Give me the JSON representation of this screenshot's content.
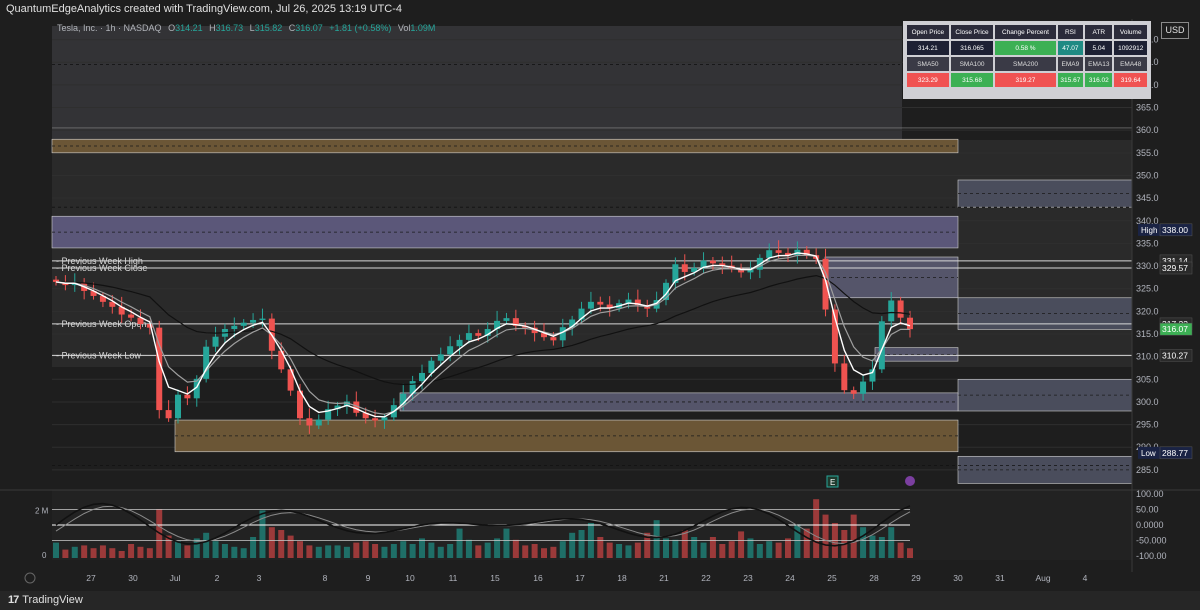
{
  "header": {
    "credit": "QuantumEdgeAnalytics created with TradingView.com, Jul 26, 2025 13:19 UTC-4"
  },
  "legend": {
    "symbol": "Tesla, Inc. · 1h · NASDAQ",
    "open_label": "O",
    "open": "314.21",
    "high_label": "H",
    "high": "316.73",
    "low_label": "L",
    "low": "315.82",
    "close_label": "C",
    "close": "316.07",
    "change": "+1.81 (+0.58%)",
    "vol_label": "Vol",
    "vol": "1.09M"
  },
  "currency": "USD",
  "stats_table": {
    "row1": [
      "Open Price",
      "Close Price",
      "Change Percent",
      "RSI",
      "ATR",
      "Volume"
    ],
    "row2": [
      "314.21",
      "316.065",
      "0.58 %",
      "47.07",
      "5.04",
      "1092912"
    ],
    "row3": [
      "SMA50",
      "SMA100",
      "SMA200",
      "EMA9",
      "EMA13",
      "EMA48"
    ],
    "row4": [
      "323.29",
      "315.68",
      "319.27",
      "315.67",
      "316.02",
      "319.64"
    ]
  },
  "colors": {
    "up": "#26a69a",
    "down": "#ef5350",
    "bg": "#1e1e1e",
    "zone_brown": "#6b5636",
    "zone_purple": "#5b5779",
    "zone_gray": "#4a4d5c"
  },
  "price_axis": {
    "min": 281,
    "max": 383,
    "ticks": [
      285,
      290,
      295,
      300,
      305,
      310,
      315,
      320,
      325,
      330,
      335,
      340,
      345,
      350,
      355,
      360,
      365,
      370,
      375,
      380
    ]
  },
  "price_tags": [
    {
      "label": "High",
      "value": 338.0,
      "text": "338.00",
      "color": "#1a2344",
      "label_show": true
    },
    {
      "label": "",
      "value": 331.14,
      "text": "331.14",
      "color": "#2a2a2a",
      "label_show": false
    },
    {
      "label": "",
      "value": 329.57,
      "text": "329.57",
      "color": "#2a2a2a",
      "label_show": false
    },
    {
      "label": "",
      "value": 317.23,
      "text": "317.23",
      "color": "#2a2a2a",
      "label_show": false
    },
    {
      "label": "",
      "value": 316.07,
      "text": "316.07",
      "color": "#3cb054",
      "label_show": false
    },
    {
      "label": "",
      "value": 310.27,
      "text": "310.27",
      "color": "#2a2a2a",
      "label_show": false
    },
    {
      "label": "Low",
      "value": 288.77,
      "text": "288.77",
      "color": "#1a2344",
      "label_show": true
    }
  ],
  "levels": [
    {
      "label": "Previous Week High",
      "value": 331.14
    },
    {
      "label": "Previous Week Close",
      "value": 329.57
    },
    {
      "label": "Previous Week Open",
      "value": 317.23
    },
    {
      "label": "Previous Week Low",
      "value": 310.27
    }
  ],
  "osc_axis": {
    "ticks": [
      {
        "v": 100,
        "t": "100.00"
      },
      {
        "v": 50,
        "t": "50.00"
      },
      {
        "v": 0,
        "t": "0.0000"
      },
      {
        "v": -50,
        "t": "-50.000"
      },
      {
        "v": -100,
        "t": "-100.00"
      }
    ]
  },
  "vol_axis": {
    "ticks": [
      "2 M",
      "0"
    ]
  },
  "time_axis": [
    "27",
    "30",
    "Jul",
    "2",
    "3",
    "8",
    "9",
    "10",
    "11",
    "15",
    "16",
    "17",
    "18",
    "21",
    "22",
    "23",
    "24",
    "25",
    "28",
    "29",
    "30",
    "31",
    "Aug",
    "4"
  ],
  "chart_data": {
    "type": "candlestick",
    "title": "Tesla, Inc. · 1h · NASDAQ",
    "ylabel": "USD",
    "ylim": [
      281,
      383
    ],
    "x_labels": [
      "27",
      "30",
      "Jul",
      "2",
      "3",
      "8",
      "9",
      "10",
      "11",
      "15",
      "16",
      "17",
      "18",
      "21",
      "22",
      "23",
      "24",
      "25",
      "28",
      "29",
      "30",
      "31",
      "Aug",
      "4"
    ],
    "zones": [
      {
        "kind": "supply",
        "y_low": 355,
        "y_high": 358,
        "from": "27",
        "to": "25"
      },
      {
        "kind": "supply",
        "y_low": 343,
        "y_high": 349,
        "from": "25",
        "to": "end"
      },
      {
        "kind": "supply",
        "y_low": 334,
        "y_high": 341,
        "from": "27",
        "to": "25"
      },
      {
        "kind": "resistance",
        "y_low": 323,
        "y_high": 332,
        "from": "24",
        "to": "25"
      },
      {
        "kind": "resistance",
        "y_low": 316,
        "y_high": 323,
        "from": "25",
        "to": "end"
      },
      {
        "kind": "support",
        "y_low": 309,
        "y_high": 312,
        "from": "25",
        "to": "25"
      },
      {
        "kind": "support",
        "y_low": 298,
        "y_high": 305,
        "from": "25",
        "to": "end"
      },
      {
        "kind": "support",
        "y_low": 298,
        "y_high": 302,
        "from": "10",
        "to": "25"
      },
      {
        "kind": "demand",
        "y_low": 289,
        "y_high": 296,
        "from": "Jul",
        "to": "25"
      },
      {
        "kind": "demand",
        "y_low": 282,
        "y_high": 288,
        "from": "25",
        "to": "end"
      }
    ],
    "close_series": [
      326.5,
      325.8,
      326.2,
      324.5,
      323.4,
      322.1,
      321.0,
      319.3,
      318.6,
      317.2,
      316.4,
      298.2,
      296.4,
      301.6,
      300.8,
      305.1,
      312.2,
      314.4,
      316.1,
      316.8,
      317.5,
      318.1,
      318.4,
      311.3,
      307.2,
      302.5,
      296.4,
      294.8,
      296.1,
      298.4,
      299.2,
      300.1,
      297.6,
      296.4,
      295.9,
      296.6,
      299.3,
      301.8,
      304.6,
      306.4,
      309.1,
      310.5,
      312.3,
      313.7,
      315.2,
      314.6,
      316.1,
      317.9,
      318.5,
      316.8,
      316.4,
      315.2,
      314.3,
      313.6,
      316.5,
      318.2,
      320.6,
      322.1,
      321.5,
      320.7,
      321.8,
      322.6,
      321.4,
      320.6,
      322.5,
      326.3,
      330.4,
      328.7,
      329.6,
      331.2,
      330.6,
      330.1,
      329.4,
      328.6,
      329.2,
      331.8,
      333.5,
      332.9,
      332.4,
      333.6,
      332.4,
      331.6,
      320.4,
      308.5,
      302.6,
      301.8,
      304.5,
      307.2,
      317.8,
      322.4,
      318.6,
      316.07
    ],
    "volume_approx_M": [
      1.1,
      0.6,
      0.8,
      0.9,
      0.7,
      0.9,
      0.7,
      0.5,
      1.0,
      0.8,
      0.7,
      3.5,
      1.6,
      1.2,
      0.9,
      1.4,
      1.8,
      1.2,
      1.0,
      0.8,
      0.7,
      1.5,
      3.4,
      2.2,
      2.0,
      1.6,
      1.2,
      0.9,
      0.8,
      0.9,
      0.9,
      0.8,
      1.1,
      1.2,
      1.0,
      0.8,
      1.0,
      1.2,
      1.0,
      1.4,
      1.1,
      0.8,
      1.0,
      2.1,
      1.3,
      0.9,
      1.1,
      1.4,
      2.1,
      1.3,
      0.9,
      1.0,
      0.7,
      0.8,
      1.2,
      1.8,
      2.0,
      2.5,
      1.5,
      1.1,
      1.0,
      0.9,
      1.1,
      1.8,
      2.7,
      1.4,
      1.3,
      2.0,
      1.5,
      1.1,
      1.5,
      1.0,
      1.2,
      1.9,
      1.4,
      1.0,
      1.2,
      1.1,
      1.4,
      2.4,
      2.1,
      4.2,
      3.1,
      2.5,
      2.0,
      3.1,
      2.2,
      1.6,
      1.5,
      2.2,
      1.1,
      0.7
    ]
  }
}
